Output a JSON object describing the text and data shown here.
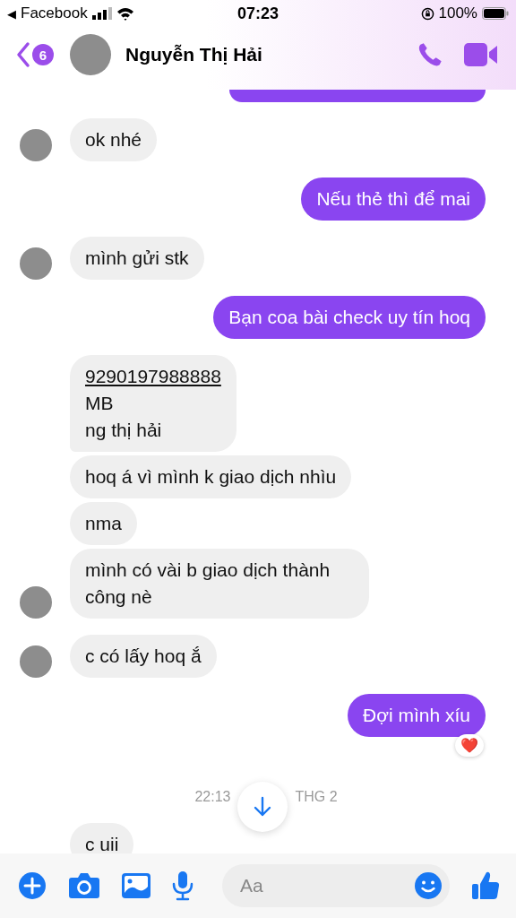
{
  "status_bar": {
    "back_arrow": "◀",
    "back_app": "Facebook",
    "time": "07:23",
    "battery": "100%"
  },
  "header": {
    "unread_count": "6",
    "contact_name": "Nguyễn Thị Hải"
  },
  "messages": [
    {
      "kind": "sent_clipped"
    },
    {
      "kind": "received",
      "text": "ok nhé",
      "avatar": true
    },
    {
      "kind": "sent",
      "text": "Nếu thẻ thì để mai"
    },
    {
      "kind": "received",
      "text": "mình gửi stk",
      "avatar": true
    },
    {
      "kind": "sent",
      "text": "Bạn coa bài check uy tín hoq"
    },
    {
      "kind": "received_account",
      "link": "9290197988888",
      "text": "MB\nng thị hải",
      "avatar": false
    },
    {
      "kind": "received",
      "text": "hoq á vì mình k giao dịch nhìu",
      "avatar": false
    },
    {
      "kind": "received",
      "text": "nma",
      "avatar": false
    },
    {
      "kind": "received",
      "text": "mình có vài b giao dịch thành công nè",
      "avatar": true
    },
    {
      "kind": "received",
      "text": "c có lấy hoq ắ",
      "avatar": true
    },
    {
      "kind": "sent",
      "text": "Đợi mình xíu",
      "reaction": "❤️"
    },
    {
      "kind": "timestamp",
      "text": "22:13",
      "text_2": "THG 2"
    },
    {
      "kind": "received",
      "text": "c uii",
      "avatar": false
    }
  ],
  "composer": {
    "placeholder": "Aa"
  }
}
